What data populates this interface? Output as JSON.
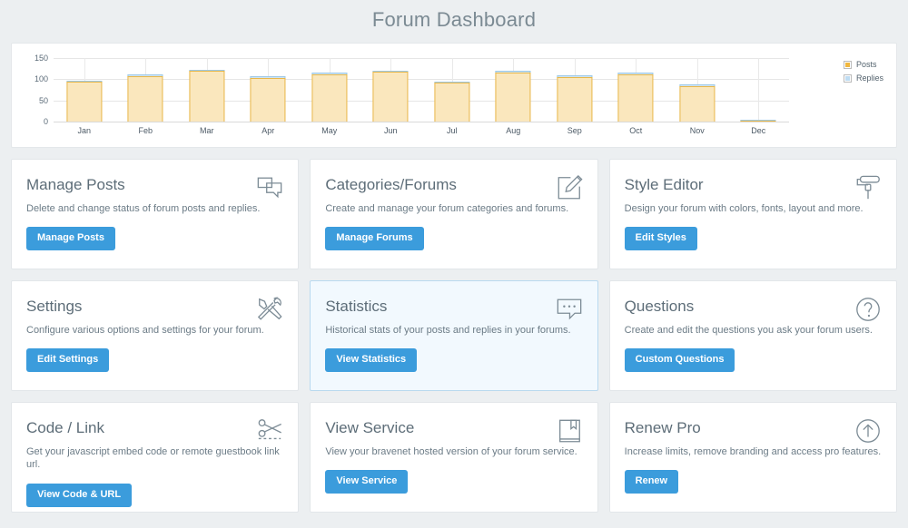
{
  "header": {
    "title": "Forum Dashboard"
  },
  "chart_data": {
    "type": "bar",
    "title": "",
    "xlabel": "",
    "ylabel": "",
    "stacked": true,
    "grid": true,
    "legend_position": "right",
    "ylim": [
      0,
      150
    ],
    "yticks": [
      0,
      50,
      100,
      150
    ],
    "categories": [
      "Jan",
      "Feb",
      "Mar",
      "Apr",
      "May",
      "Jun",
      "Jul",
      "Aug",
      "Sep",
      "Oct",
      "Nov",
      "Dec"
    ],
    "series": [
      {
        "name": "Posts",
        "color": "#fae7bd",
        "values": [
          94,
          107,
          119,
          103,
          111,
          117,
          92,
          115,
          105,
          111,
          84,
          0
        ]
      },
      {
        "name": "Replies",
        "color": "#cfe4f2",
        "values": [
          3,
          4,
          4,
          4,
          4,
          4,
          3,
          4,
          4,
          4,
          3,
          2
        ]
      }
    ]
  },
  "cards": [
    {
      "title": "Manage Posts",
      "description": "Delete and change status of forum posts and replies.",
      "button": "Manage Posts",
      "icon": "chat-bubbles-icon",
      "active": false
    },
    {
      "title": "Categories/Forums",
      "description": "Create and manage your forum categories and forums.",
      "button": "Manage Forums",
      "icon": "pencil-square-icon",
      "active": false
    },
    {
      "title": "Style Editor",
      "description": "Design your forum with colors, fonts, layout and more.",
      "button": "Edit Styles",
      "icon": "paint-roller-icon",
      "active": false
    },
    {
      "title": "Settings",
      "description": "Configure various options and settings for your forum.",
      "button": "Edit Settings",
      "icon": "wrench-screwdriver-icon",
      "active": false
    },
    {
      "title": "Statistics",
      "description": "Historical stats of your posts and replies in your forums.",
      "button": "View Statistics",
      "icon": "speech-bubble-ellipsis-icon",
      "active": true
    },
    {
      "title": "Questions",
      "description": "Create and edit the questions you ask your forum users.",
      "button": "Custom Questions",
      "icon": "question-circle-icon",
      "active": false
    },
    {
      "title": "Code / Link",
      "description": "Get your javascript embed code or remote guestbook link url.",
      "button": "View Code & URL",
      "icon": "scissors-icon",
      "active": false
    },
    {
      "title": "View Service",
      "description": "View your bravenet hosted version of your forum service.",
      "button": "View Service",
      "icon": "bookmark-book-icon",
      "active": false
    },
    {
      "title": "Renew Pro",
      "description": "Increase limits, remove branding and access pro features.",
      "button": "Renew",
      "icon": "arrow-up-circle-icon",
      "active": false
    }
  ],
  "colors": {
    "page_background": "#eceff1",
    "card_background": "#ffffff",
    "accent_button": "#3b9cdc",
    "posts_bar": "#fae7bd",
    "posts_border": "#e8b84b",
    "replies_bar": "#cfe4f2",
    "replies_border": "#9ec9e6",
    "title_text": "#7b8a93",
    "active_card_background": "#f2f9fe"
  }
}
